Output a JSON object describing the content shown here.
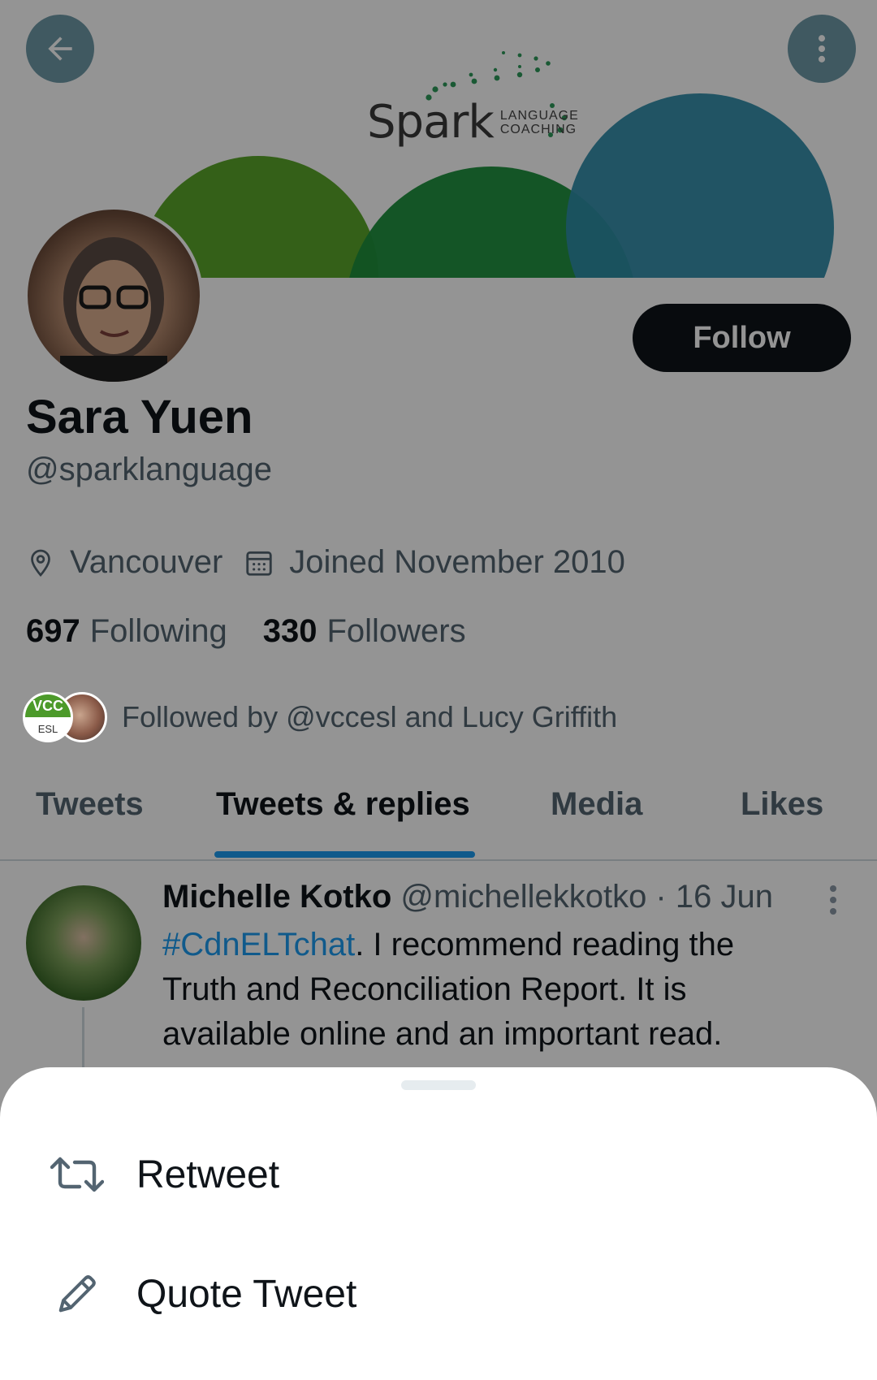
{
  "banner": {
    "logo_word": "Spark",
    "logo_sub_line1": "LANGUAGE",
    "logo_sub_line2": "COACHING"
  },
  "header": {
    "back_icon": "arrow-left-icon",
    "more_icon": "more-vertical-icon"
  },
  "profile": {
    "name": "Sara Yuen",
    "handle": "@sparklanguage",
    "follow_label": "Follow",
    "location": "Vancouver",
    "joined": "Joined November 2010",
    "following_count": "697",
    "following_label": "Following",
    "followers_count": "330",
    "followers_label": "Followers",
    "followed_by": "Followed by @vccesl and Lucy Griffith",
    "followed_avatar_top": "VCC",
    "followed_avatar_bottom": "ESL"
  },
  "tabs": [
    {
      "label": "Tweets"
    },
    {
      "label": "Tweets & replies"
    },
    {
      "label": "Media"
    },
    {
      "label": "Likes"
    }
  ],
  "active_tab_index": 1,
  "tweet": {
    "author": "Michelle Kotko",
    "handle_time": "@michellekkotko · 16 Jun",
    "hashtag": "#CdnELTchat",
    "text": ". I recommend reading the Truth and Reconciliation Report. It is available online and an important read."
  },
  "sheet": {
    "items": [
      {
        "label": "Retweet",
        "icon": "retweet-icon"
      },
      {
        "label": "Quote Tweet",
        "icon": "pencil-icon"
      }
    ]
  },
  "colors": {
    "accent": "#1d9bf0",
    "text_primary": "#0f1419",
    "text_secondary": "#536471",
    "banner_green_light": "#5aa52a",
    "banner_green_dark": "#1d8f3c",
    "banner_teal": "#2f8ca8"
  }
}
